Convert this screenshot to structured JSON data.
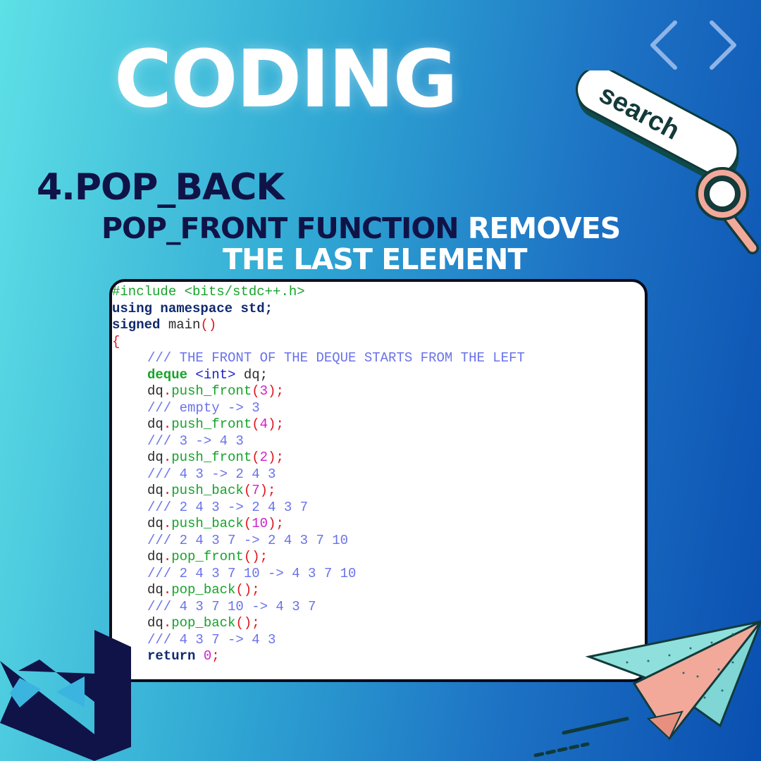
{
  "title": "CODING",
  "heading": "4.POP_BACK",
  "subtitle": {
    "line1_dark": "POP_FRONT FUNCTION",
    "line1_light": "REMOVES",
    "line2": "THE LAST ELEMENT"
  },
  "search_text": "search",
  "icons": {
    "prev": "chevron-left-icon",
    "next": "chevron-right-icon",
    "search": "magnifier-icon",
    "logo": "visual-studio-logo",
    "plane": "paper-plane-icon"
  },
  "colors": {
    "dark_navy": "#101347",
    "white": "#ffffff",
    "keyword": "#102a6e",
    "comment": "#6a72ea",
    "include": "#16a32a",
    "number": "#d020c8",
    "punct": "#e0161e"
  },
  "code": {
    "include": "#include <bits/stdc++.h>",
    "using": "using",
    "namespace": "namespace",
    "std": "std;",
    "signed": "signed",
    "main": "main",
    "paren": "()",
    "open_brace": "{",
    "comment1": "/// THE FRONT OF THE DEQUE STARTS FROM THE LEFT",
    "deque": "deque",
    "int_type": "<int>",
    "dq_decl": "dq;",
    "dq": "dq",
    "dot": ".",
    "push_front": "push_front",
    "push_back": "push_back",
    "pop_front": "pop_front",
    "pop_back": "pop_back",
    "lp": "(",
    "rp_semi": ");",
    "empty_call": "();",
    "n3": "3",
    "n4": "4",
    "n2": "2",
    "n7": "7",
    "n10": "10",
    "c2": "/// empty -> 3",
    "c3": "/// 3 -> 4 3",
    "c4": "/// 4 3 -> 2 4 3",
    "c5": "/// 2 4 3 -> 2 4 3 7",
    "c6": "/// 2 4 3 7 -> 2 4 3 7 10",
    "c7": "/// 2 4 3 7 10 -> 4 3 7 10",
    "c8": "/// 4 3 7 10 -> 4 3 7",
    "c9": "/// 4 3 7 -> 4 3",
    "return": "return",
    "zero": "0",
    "semi": ";"
  }
}
